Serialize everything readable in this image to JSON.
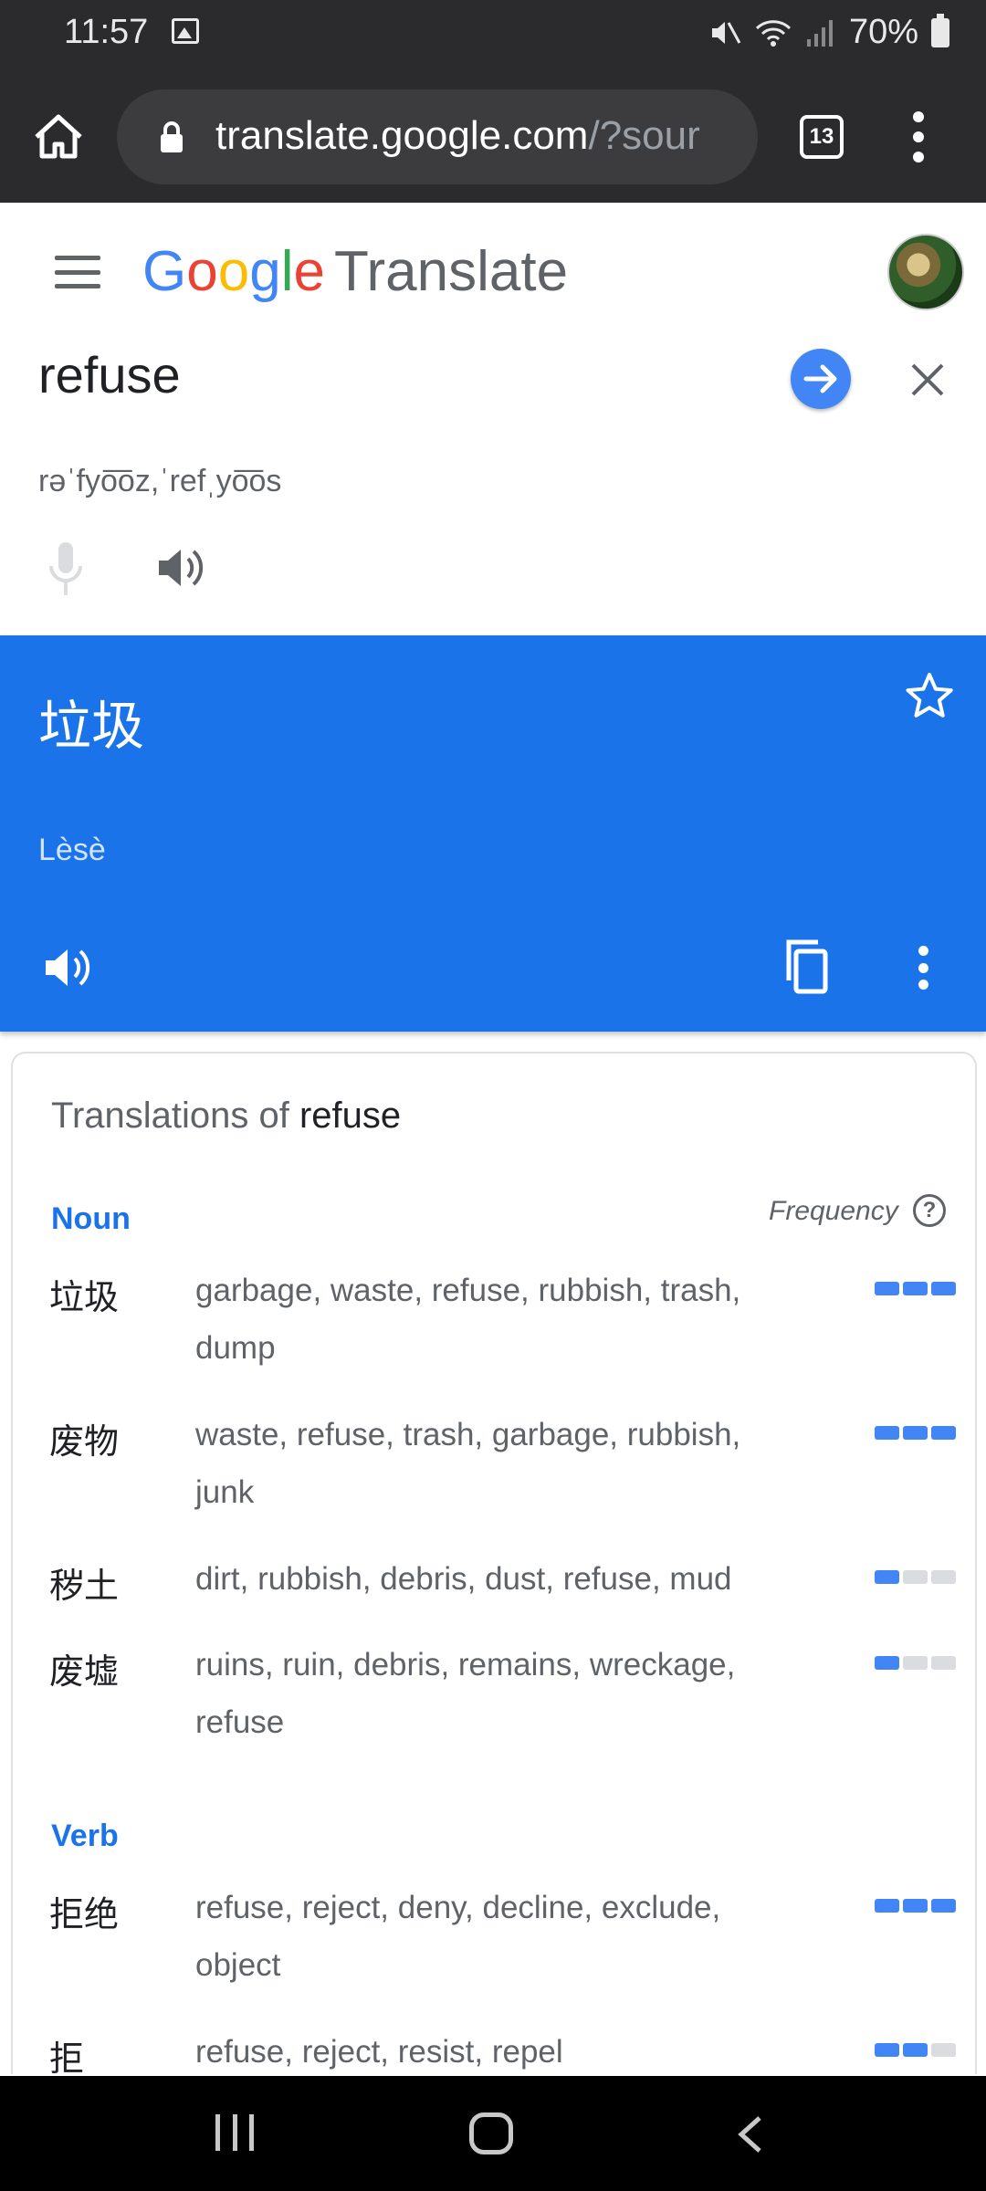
{
  "status_bar": {
    "time": "11:57",
    "battery": "70%"
  },
  "browser": {
    "url_host": "translate.google.com",
    "url_path": "/?sour",
    "tab_count": "13"
  },
  "app": {
    "logo_letters": [
      "G",
      "o",
      "o",
      "g",
      "l",
      "e"
    ],
    "logo_product": "Translate"
  },
  "source": {
    "text": "refuse",
    "phonetic": "rəˈfyo͞oz,ˈrefˌyo͞os"
  },
  "result": {
    "text": "垃圾",
    "romanized": "Lèsè"
  },
  "translations": {
    "title_prefix": "Translations of",
    "title_word": "refuse",
    "frequency_label": "Frequency",
    "help_glyph": "?",
    "groups": [
      {
        "pos": "Noun",
        "rows": [
          {
            "word": "垃圾",
            "synonyms": "garbage, waste, refuse, rubbish, trash, dump",
            "frequency": 3
          },
          {
            "word": "废物",
            "synonyms": "waste, refuse, trash, garbage, rubbish, junk",
            "frequency": 3
          },
          {
            "word": "秽土",
            "synonyms": "dirt, rubbish, debris, dust, refuse, mud",
            "frequency": 1
          },
          {
            "word": "废墟",
            "synonyms": "ruins, ruin, debris, remains, wreckage, refuse",
            "frequency": 1
          }
        ]
      },
      {
        "pos": "Verb",
        "rows": [
          {
            "word": "拒绝",
            "synonyms": "refuse, reject, deny, decline, exclude, object",
            "frequency": 3
          },
          {
            "word": "拒",
            "synonyms": "refuse, reject, resist, repel",
            "frequency": 2
          }
        ]
      }
    ]
  },
  "icons": {
    "home": "home-icon",
    "lock": "lock-icon",
    "tabs": "tab-switcher-icon",
    "menu": "overflow-menu-icon",
    "hamburger": "hamburger-menu-icon",
    "go": "arrow-right-icon",
    "clear": "close-icon",
    "mic": "microphone-icon",
    "speaker": "speaker-icon",
    "star": "star-icon",
    "copy": "copy-icon"
  },
  "colors": {
    "accent": "#1a73e8",
    "browser_chrome": "#2b2b2d",
    "frequency_on": "#4285f4",
    "frequency_off": "#dadce0"
  }
}
